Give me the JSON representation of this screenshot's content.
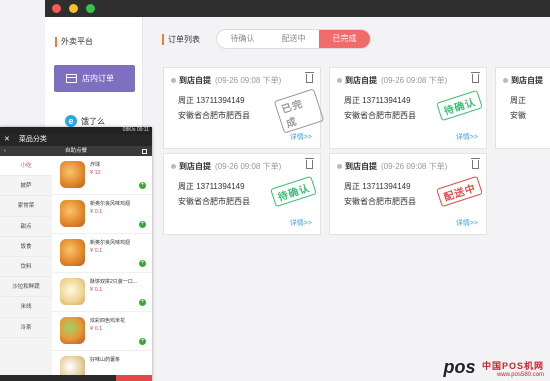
{
  "sidebar": {
    "title": "外卖平台",
    "nav_order": "店内订单",
    "nav_hungry": "饿了么",
    "hungry_icon_letter": "e"
  },
  "main": {
    "title": "订单列表",
    "tabs": [
      {
        "label": "待确认",
        "active": false
      },
      {
        "label": "配送中",
        "active": false
      },
      {
        "label": "已完成",
        "active": true
      }
    ],
    "cards": [
      {
        "type": "到店自提",
        "time": "(09-26 09:08 下单)",
        "name": "周正  13711394149",
        "addr": "安徽省合肥市肥西县",
        "stamp": "已完成",
        "stamp_color": "gray",
        "detail": "详情>>"
      },
      {
        "type": "到店自提",
        "time": "(09-26 09:08 下单)",
        "name": "周正  13711394149",
        "addr": "安徽省合肥市肥西县",
        "stamp": "待确认",
        "stamp_color": "green",
        "detail": "详情>>"
      },
      {
        "type": "到店自提",
        "time": "",
        "name": "周正",
        "addr": "安徽",
        "stamp": "",
        "stamp_color": "",
        "detail": ""
      },
      {
        "type": "到店自提",
        "time": "(09-26 09:08 下单)",
        "name": "周正  13711394149",
        "addr": "安徽省合肥市肥西县",
        "stamp": "待确认",
        "stamp_color": "green",
        "detail": "详情>>"
      },
      {
        "type": "到店自提",
        "time": "(09-26 09:08 下单)",
        "name": "周正  13711394149",
        "addr": "安徽省合肥市肥西县",
        "stamp": "配送中",
        "stamp_color": "red",
        "detail": "详情>>"
      }
    ]
  },
  "phone": {
    "status": "08K/s  09:11",
    "title": "菜品分类",
    "subtitle": "自助点餐",
    "categories": [
      "小吃",
      "披萨",
      "家常菜",
      "甜点",
      "饭食",
      "饮料",
      "沙拉和鲜蔬",
      "米线",
      "冷茶"
    ],
    "active_category": 0,
    "items": [
      {
        "name": "炸球",
        "price": "¥ 12",
        "pic": "fried"
      },
      {
        "name": "新奥尔良风味鸡翅",
        "price": "¥ 0.1",
        "pic": "fried"
      },
      {
        "name": "新奥尔良风味鸡翅",
        "price": "¥ 0.1",
        "pic": "fried"
      },
      {
        "name": "酥饼双拼2只装一口...",
        "price": "¥ 0.1",
        "pic": "egg"
      },
      {
        "name": "炫彩四色鸡米花",
        "price": "¥ 0.1",
        "pic": "mix"
      },
      {
        "name": "好味山药薯条",
        "price": "",
        "pic": "rice"
      }
    ]
  },
  "watermark": {
    "logo": "pos",
    "name": "中国POS机网",
    "url": "www.pos580.com"
  },
  "colors": {
    "accent_purple": "#7e6fc1",
    "tab_active": "#f26a6a",
    "stamp_gray": "#9a9a9a",
    "stamp_green": "#3cbf74",
    "stamp_red": "#e24a4a",
    "link_blue": "#37a6dd",
    "title_bar_orange": "#f07c38"
  }
}
